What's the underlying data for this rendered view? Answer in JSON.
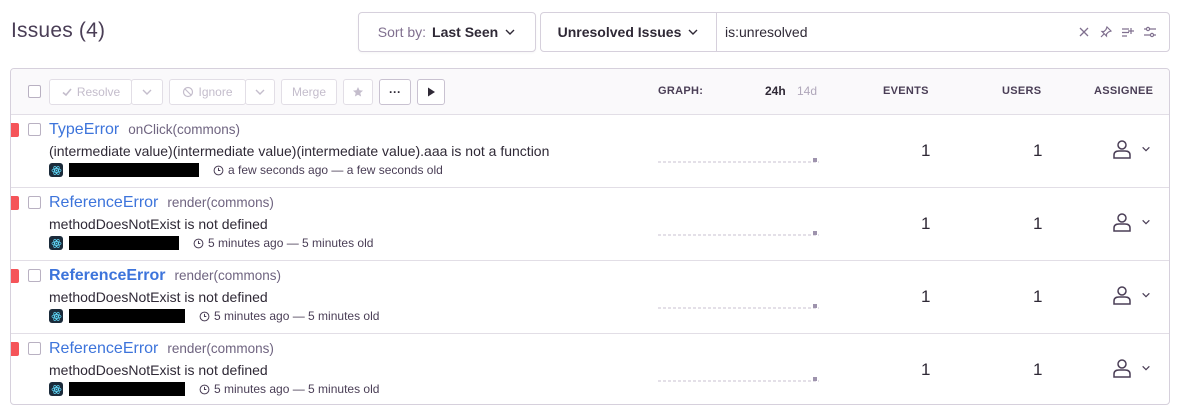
{
  "header": {
    "title": "Issues (4)",
    "sort_prefix": "Sort by:",
    "sort_value": "Last Seen",
    "saved_search": "Unresolved Issues",
    "query": "is:unresolved"
  },
  "toolbar": {
    "resolve_label": "Resolve",
    "ignore_label": "Ignore",
    "merge_label": "Merge",
    "more_label": "···",
    "graph_label": "GRAPH:",
    "period_24h": "24h",
    "period_14d": "14d",
    "events_label": "EVENTS",
    "users_label": "USERS",
    "assignee_label": "ASSIGNEE"
  },
  "colors": {
    "link": "#3d74db",
    "level_error": "#f55459",
    "text": "#2f2936",
    "border": "#d6d0dc"
  },
  "issues": [
    {
      "type": "TypeError",
      "culprit": "onClick(commons)",
      "message": "(intermediate value)(intermediate value)(intermediate value).aaa is not a function",
      "time": "a few seconds ago — a few seconds old",
      "events": "1",
      "users": "1",
      "platform_icon": "react-icon",
      "assignee_icon": "user-icon"
    },
    {
      "type": "ReferenceError",
      "culprit": "render(commons)",
      "message": "methodDoesNotExist is not defined",
      "time": "5 minutes ago — 5 minutes old",
      "events": "1",
      "users": "1",
      "platform_icon": "react-icon",
      "assignee_icon": "user-icon"
    },
    {
      "type": "ReferenceError",
      "culprit": "render(commons)",
      "message": "methodDoesNotExist is not defined",
      "time": "5 minutes ago — 5 minutes old",
      "events": "1",
      "users": "1",
      "platform_icon": "react-icon",
      "assignee_icon": "user-icon"
    },
    {
      "type": "ReferenceError",
      "culprit": "render(commons)",
      "message": "methodDoesNotExist is not defined",
      "time": "5 minutes ago — 5 minutes old",
      "events": "1",
      "users": "1",
      "platform_icon": "react-icon",
      "assignee_icon": "user-icon"
    }
  ]
}
